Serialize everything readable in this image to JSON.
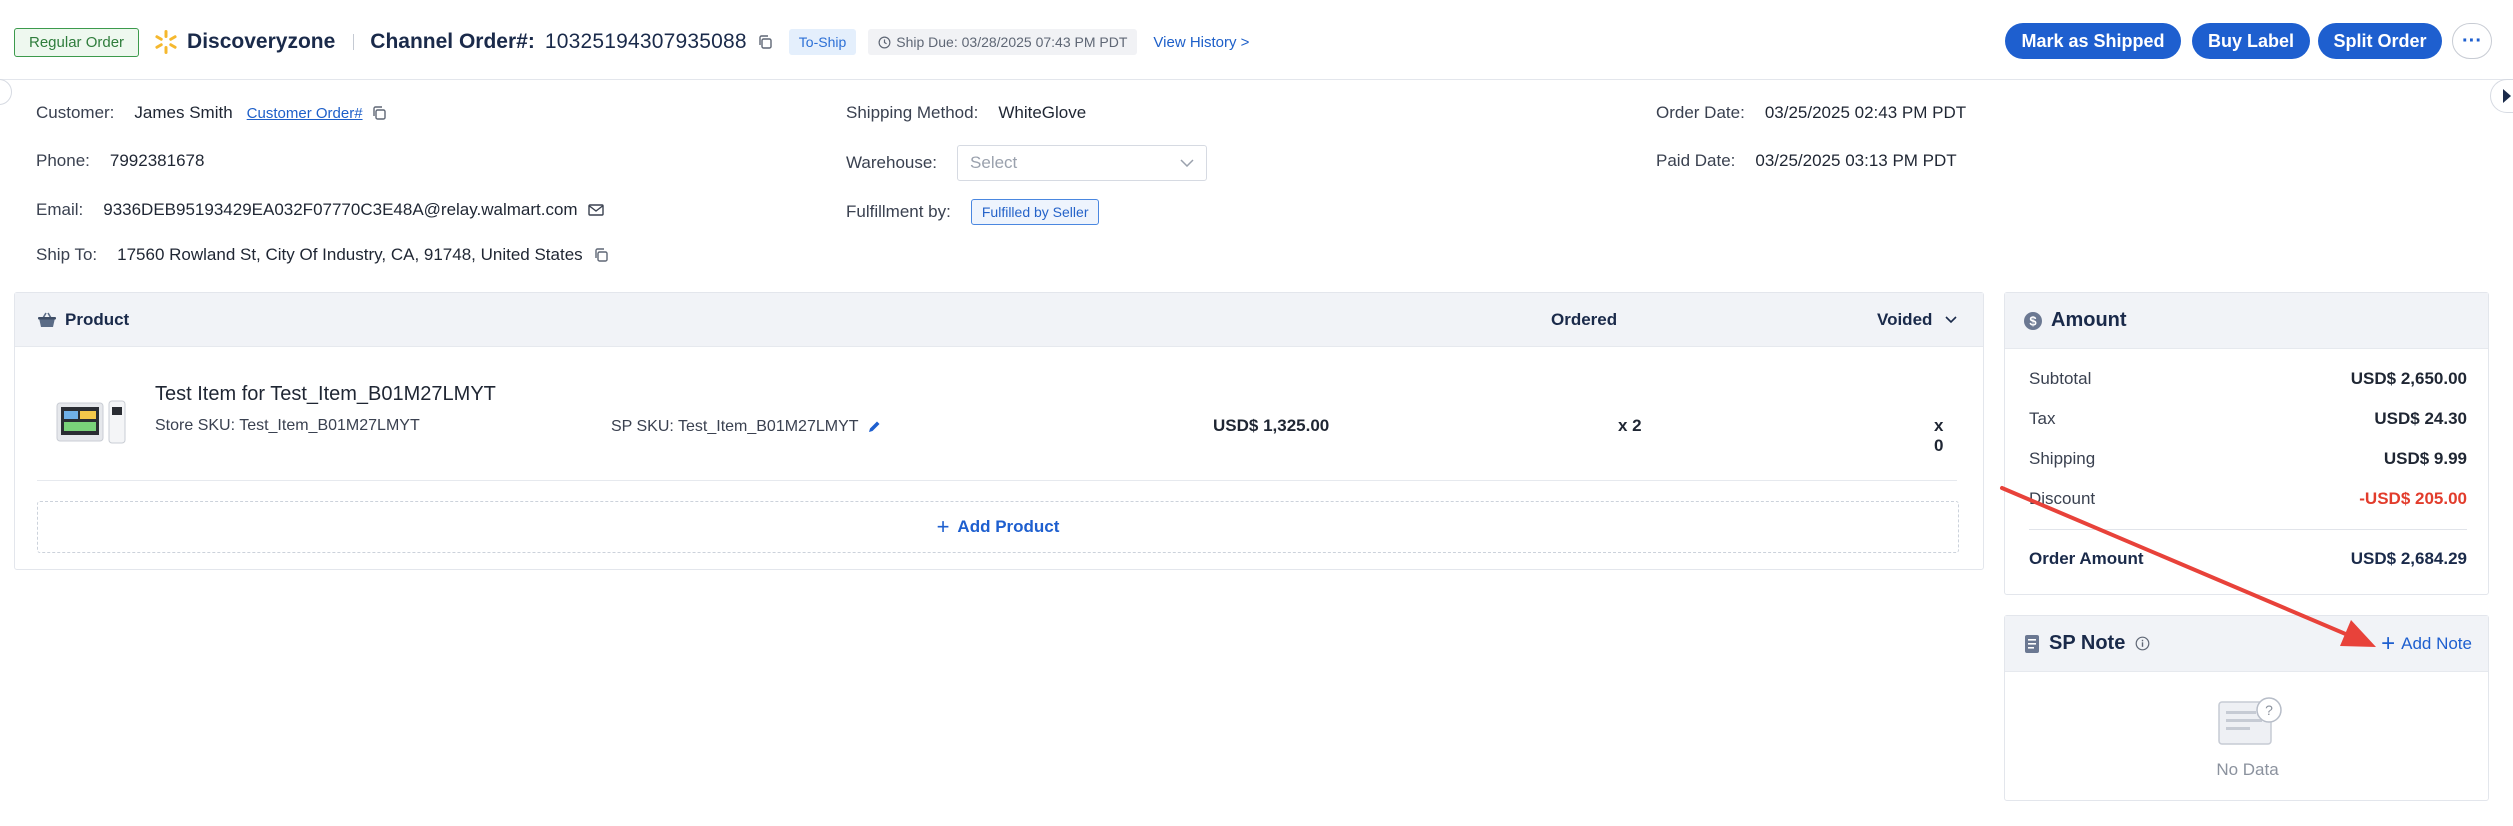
{
  "header": {
    "order_type": "Regular Order",
    "store_name": "Discoveryzone",
    "channel_order_label": "Channel Order#:",
    "channel_order_number": "10325194307935088",
    "status_tag": "To-Ship",
    "ship_due": "Ship Due: 03/28/2025 07:43 PM PDT",
    "view_history": "View History >",
    "buttons": {
      "mark_shipped": "Mark as Shipped",
      "buy_label": "Buy Label",
      "split_order": "Split Order",
      "more": "···"
    }
  },
  "info": {
    "customer_label": "Customer:",
    "customer_value": "James Smith",
    "customer_order_link": "Customer Order#",
    "phone_label": "Phone:",
    "phone_value": "7992381678",
    "email_label": "Email:",
    "email_value": "9336DEB95193429EA032F07770C3E48A@relay.walmart.com",
    "ship_to_label": "Ship To:",
    "ship_to_value": "17560 Rowland St, City Of Industry, CA, 91748, United States",
    "shipping_method_label": "Shipping Method:",
    "shipping_method_value": "WhiteGlove",
    "warehouse_label": "Warehouse:",
    "warehouse_placeholder": "Select",
    "fulfillment_label": "Fulfillment by:",
    "fulfillment_value": "Fulfilled by Seller",
    "order_date_label": "Order Date:",
    "order_date_value": "03/25/2025 02:43 PM PDT",
    "paid_date_label": "Paid Date:",
    "paid_date_value": "03/25/2025 03:13 PM PDT"
  },
  "product": {
    "title": "Product",
    "col_ordered": "Ordered",
    "col_voided": "Voided",
    "items": [
      {
        "name": "Test Item for Test_Item_B01M27LMYT",
        "store_sku": "Store SKU: Test_Item_B01M27LMYT",
        "sp_sku": "SP SKU: Test_Item_B01M27LMYT",
        "price": "USD$ 1,325.00",
        "ordered": "x 2",
        "voided": "x 0"
      }
    ],
    "add_product": "Add Product"
  },
  "amount": {
    "title": "Amount",
    "rows": [
      {
        "label": "Subtotal",
        "value": "USD$ 2,650.00"
      },
      {
        "label": "Tax",
        "value": "USD$ 24.30"
      },
      {
        "label": "Shipping",
        "value": "USD$ 9.99"
      },
      {
        "label": "Discount",
        "value": "-USD$ 205.00"
      }
    ],
    "total_label": "Order Amount",
    "total_value": "USD$ 2,684.29"
  },
  "note": {
    "title": "SP Note",
    "add_note": "Add Note",
    "empty": "No Data"
  },
  "colors": {
    "primary": "#1e5fcf",
    "negative": "#e23c2c",
    "annotation_arrow": "#e8423a"
  }
}
